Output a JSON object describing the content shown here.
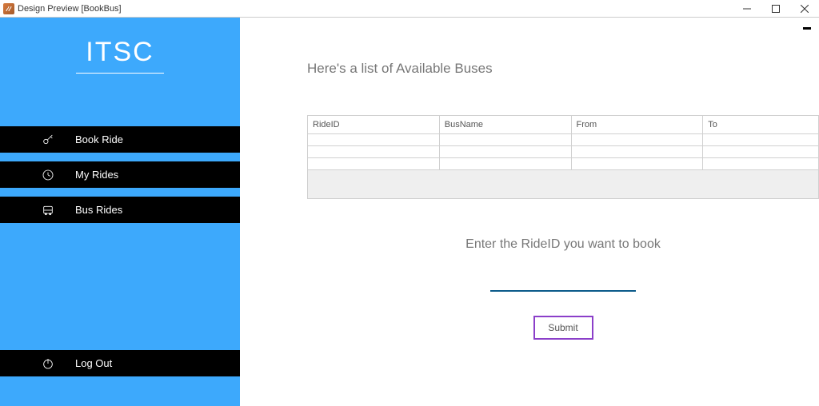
{
  "window": {
    "title": "Design Preview [BookBus]"
  },
  "sidebar": {
    "brand": "ITSC",
    "items": [
      {
        "label": "Book Ride"
      },
      {
        "label": "My Rides"
      },
      {
        "label": "Bus Rides"
      }
    ],
    "logout_label": "Log Out"
  },
  "main": {
    "heading": "Here's a list of Available Buses",
    "columns": {
      "rideid": "RideID",
      "busname": "BusName",
      "from": "From",
      "to": "To"
    },
    "prompt": "Enter the RideID you want to book",
    "input_value": "",
    "submit_label": "Submit"
  }
}
